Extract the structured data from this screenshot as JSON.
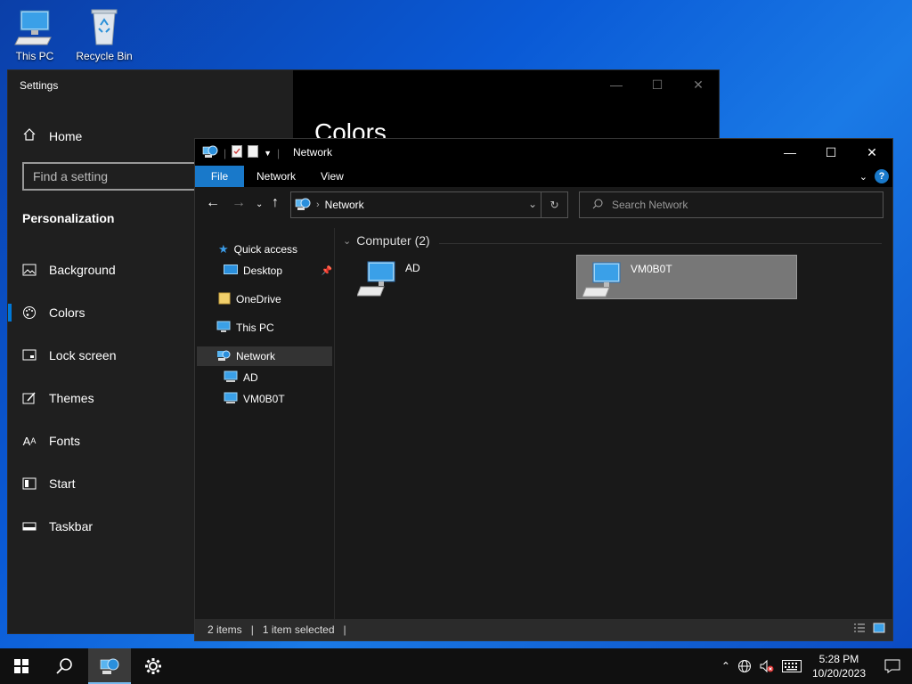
{
  "desktop": {
    "icons": [
      {
        "label": "This PC"
      },
      {
        "label": "Recycle Bin"
      }
    ]
  },
  "settings": {
    "title": "Settings",
    "home_label": "Home",
    "search_placeholder": "Find a setting",
    "section_title": "Personalization",
    "page_heading": "Colors",
    "nav_items": [
      {
        "label": "Background",
        "icon": "picture-icon"
      },
      {
        "label": "Colors",
        "icon": "palette-icon",
        "active": true
      },
      {
        "label": "Lock screen",
        "icon": "lock-screen-icon"
      },
      {
        "label": "Themes",
        "icon": "themes-icon"
      },
      {
        "label": "Fonts",
        "icon": "fonts-icon"
      },
      {
        "label": "Start",
        "icon": "start-icon"
      },
      {
        "label": "Taskbar",
        "icon": "taskbar-icon"
      }
    ]
  },
  "explorer": {
    "title": "Network",
    "ribbon_tabs": [
      {
        "label": "File"
      },
      {
        "label": "Network"
      },
      {
        "label": "View"
      }
    ],
    "help_label": "?",
    "address": {
      "location": "Network"
    },
    "search": {
      "placeholder": "Search Network"
    },
    "tree": [
      {
        "label": "Quick access"
      },
      {
        "label": "Desktop"
      },
      {
        "label": "OneDrive"
      },
      {
        "label": "This PC"
      },
      {
        "label": "Network",
        "selected": true
      },
      {
        "label": "AD"
      },
      {
        "label": "VM0B0T"
      }
    ],
    "group": {
      "label": "Computer (2)"
    },
    "items": [
      {
        "name": "AD",
        "selected": false
      },
      {
        "name": "VM0B0T",
        "selected": true
      }
    ],
    "status": {
      "count": "2 items",
      "selection": "1 item selected"
    }
  },
  "taskbar": {
    "time": "5:28 PM",
    "date": "10/20/2023"
  },
  "colors": {
    "accent": "#0078d7",
    "file_tab": "#1979ca",
    "selection": "#777777"
  }
}
